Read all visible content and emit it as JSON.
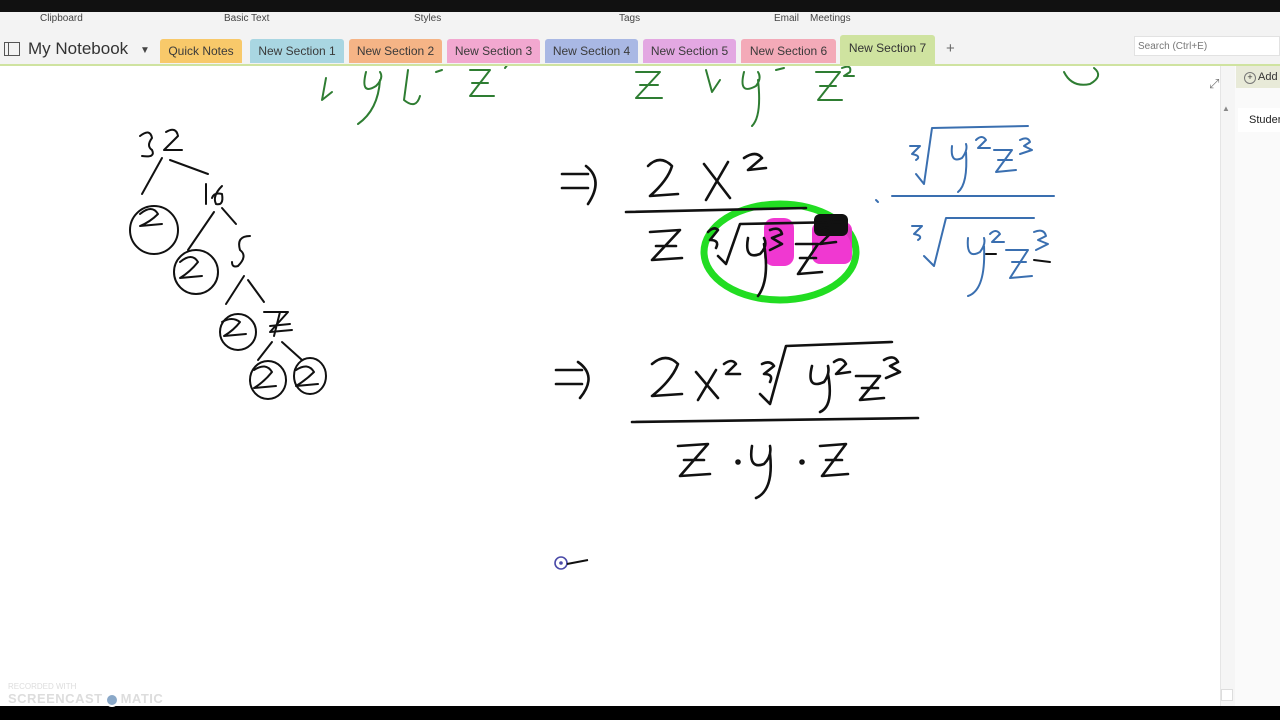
{
  "ribbon": {
    "groups": [
      "Clipboard",
      "Basic Text",
      "Styles",
      "Tags",
      "Email",
      "Meetings"
    ]
  },
  "notebook": {
    "title": "My Notebook"
  },
  "tabs": [
    {
      "label": "Quick Notes",
      "color": "#f8c96a",
      "active": false
    },
    {
      "label": "New Section 1",
      "color": "#a9d6e2",
      "active": false
    },
    {
      "label": "New Section 2",
      "color": "#f5b486",
      "active": false
    },
    {
      "label": "New Section 3",
      "color": "#f2a8d0",
      "active": false
    },
    {
      "label": "New Section 4",
      "color": "#a9b8e4",
      "active": false
    },
    {
      "label": "New Section 5",
      "color": "#e3a8e2",
      "active": false
    },
    {
      "label": "New Section 6",
      "color": "#f3aab8",
      "active": false
    },
    {
      "label": "New Section 7",
      "color": "#cfe3a0",
      "active": true
    }
  ],
  "add_tab": "+",
  "search": {
    "placeholder": "Search (Ctrl+E)"
  },
  "right_panel": {
    "add_page": "Add Page",
    "page_item": "Student"
  },
  "watermark": {
    "line1": "RECORDED WITH",
    "line2a": "SCREENCAST",
    "line2b": "MATIC"
  },
  "colors": {
    "ink_black": "#111111",
    "ink_green": "#2e7d32",
    "ink_blue": "#3a6fb0",
    "highlight_green": "#22dd22",
    "highlight_pink": "#ee22cc",
    "cursor": "#4a4aa8"
  }
}
